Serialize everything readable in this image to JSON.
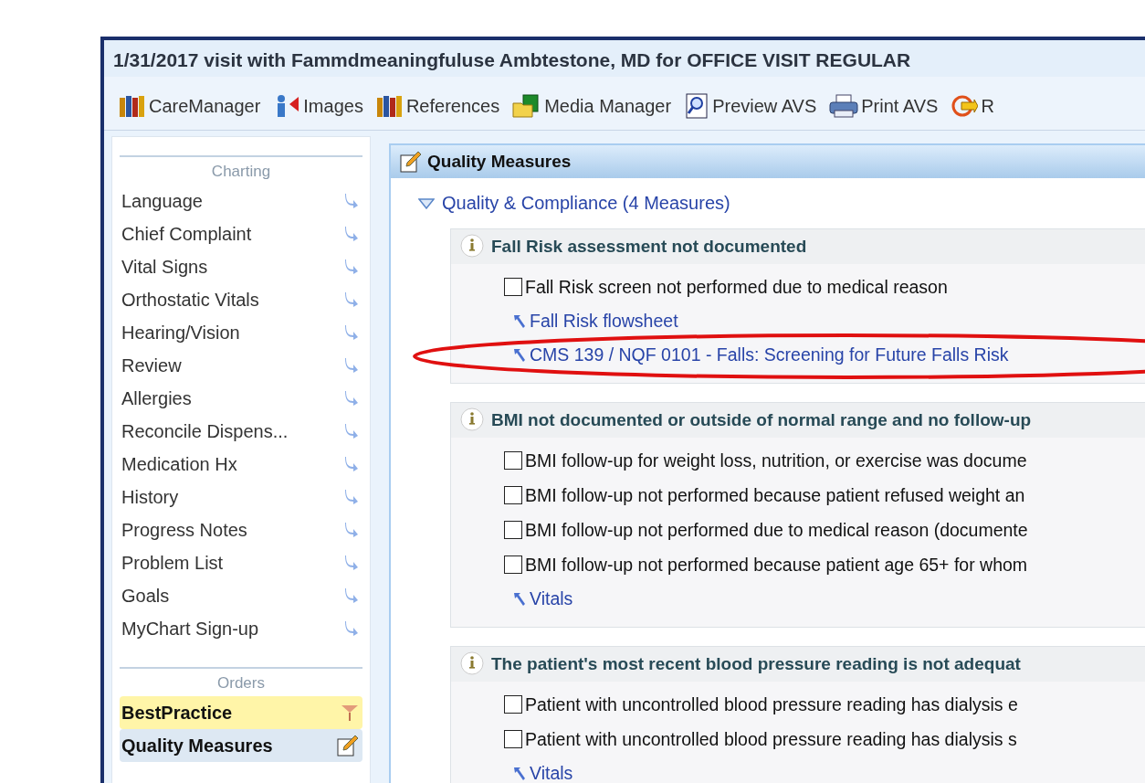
{
  "window": {
    "title": "1/31/2017 visit with Fammdmeaningfuluse Ambtestone, MD for OFFICE VISIT REGULAR"
  },
  "toolbar": [
    {
      "label": "CareManager",
      "kind": "books"
    },
    {
      "label": "Images",
      "kind": "person"
    },
    {
      "label": "References",
      "kind": "books"
    },
    {
      "label": "Media Manager",
      "kind": "folder"
    },
    {
      "label": "Preview AVS",
      "kind": "preview"
    },
    {
      "label": "Print AVS",
      "kind": "printer"
    },
    {
      "label": "R",
      "kind": "refresh"
    }
  ],
  "sidebar": {
    "sections": [
      {
        "heading": "Charting",
        "items": [
          {
            "label": "Language",
            "kind": "jump"
          },
          {
            "label": "Chief Complaint",
            "kind": "jump"
          },
          {
            "label": "Vital Signs",
            "kind": "jump"
          },
          {
            "label": "Orthostatic Vitals",
            "kind": "jump"
          },
          {
            "label": "Hearing/Vision",
            "kind": "jump"
          },
          {
            "label": "Review",
            "kind": "jump"
          },
          {
            "label": "Allergies",
            "kind": "jump"
          },
          {
            "label": "Reconcile Dispens...",
            "kind": "jump"
          },
          {
            "label": "Medication Hx",
            "kind": "jump"
          },
          {
            "label": "History",
            "kind": "jump"
          },
          {
            "label": "Progress Notes",
            "kind": "jump"
          },
          {
            "label": "Problem List",
            "kind": "jump"
          },
          {
            "label": "Goals",
            "kind": "jump"
          },
          {
            "label": "MyChart Sign-up",
            "kind": "jump"
          }
        ]
      },
      {
        "heading": "Orders",
        "items": [
          {
            "label": "BestPractice",
            "kind": "alert"
          },
          {
            "label": "Quality Measures",
            "kind": "active"
          }
        ]
      }
    ]
  },
  "panel": {
    "title": "Quality Measures",
    "group": {
      "label": "Quality & Compliance (4 Measures)",
      "expanded": true
    },
    "measures": [
      {
        "title": "Fall Risk assessment not documented",
        "options": [
          {
            "label": "Fall Risk screen not performed due to medical reason",
            "checked": false
          }
        ],
        "links": [
          {
            "label": "Fall Risk flowsheet",
            "circled": false
          },
          {
            "label": "CMS 139 / NQF 0101 - Falls: Screening for Future Falls Risk",
            "circled": true
          }
        ]
      },
      {
        "title": "BMI not documented or outside of normal range and no follow-up",
        "options": [
          {
            "label": "BMI follow-up for weight loss, nutrition, or exercise was docume",
            "checked": false
          },
          {
            "label": "BMI follow-up not performed because patient refused weight an",
            "checked": false
          },
          {
            "label": "BMI follow-up not performed due to medical reason (documente",
            "checked": false
          },
          {
            "label": "BMI follow-up not performed because patient age 65+ for whom",
            "checked": false
          }
        ],
        "links": [
          {
            "label": "Vitals",
            "circled": false
          }
        ]
      },
      {
        "title": "The patient's most recent blood pressure reading is not adequat",
        "options": [
          {
            "label": "Patient with uncontrolled blood pressure reading has dialysis e",
            "checked": false
          },
          {
            "label": "Patient with uncontrolled blood pressure reading has dialysis s",
            "checked": false
          }
        ],
        "links": [
          {
            "label": "Vitals",
            "circled": false
          }
        ]
      }
    ]
  }
}
